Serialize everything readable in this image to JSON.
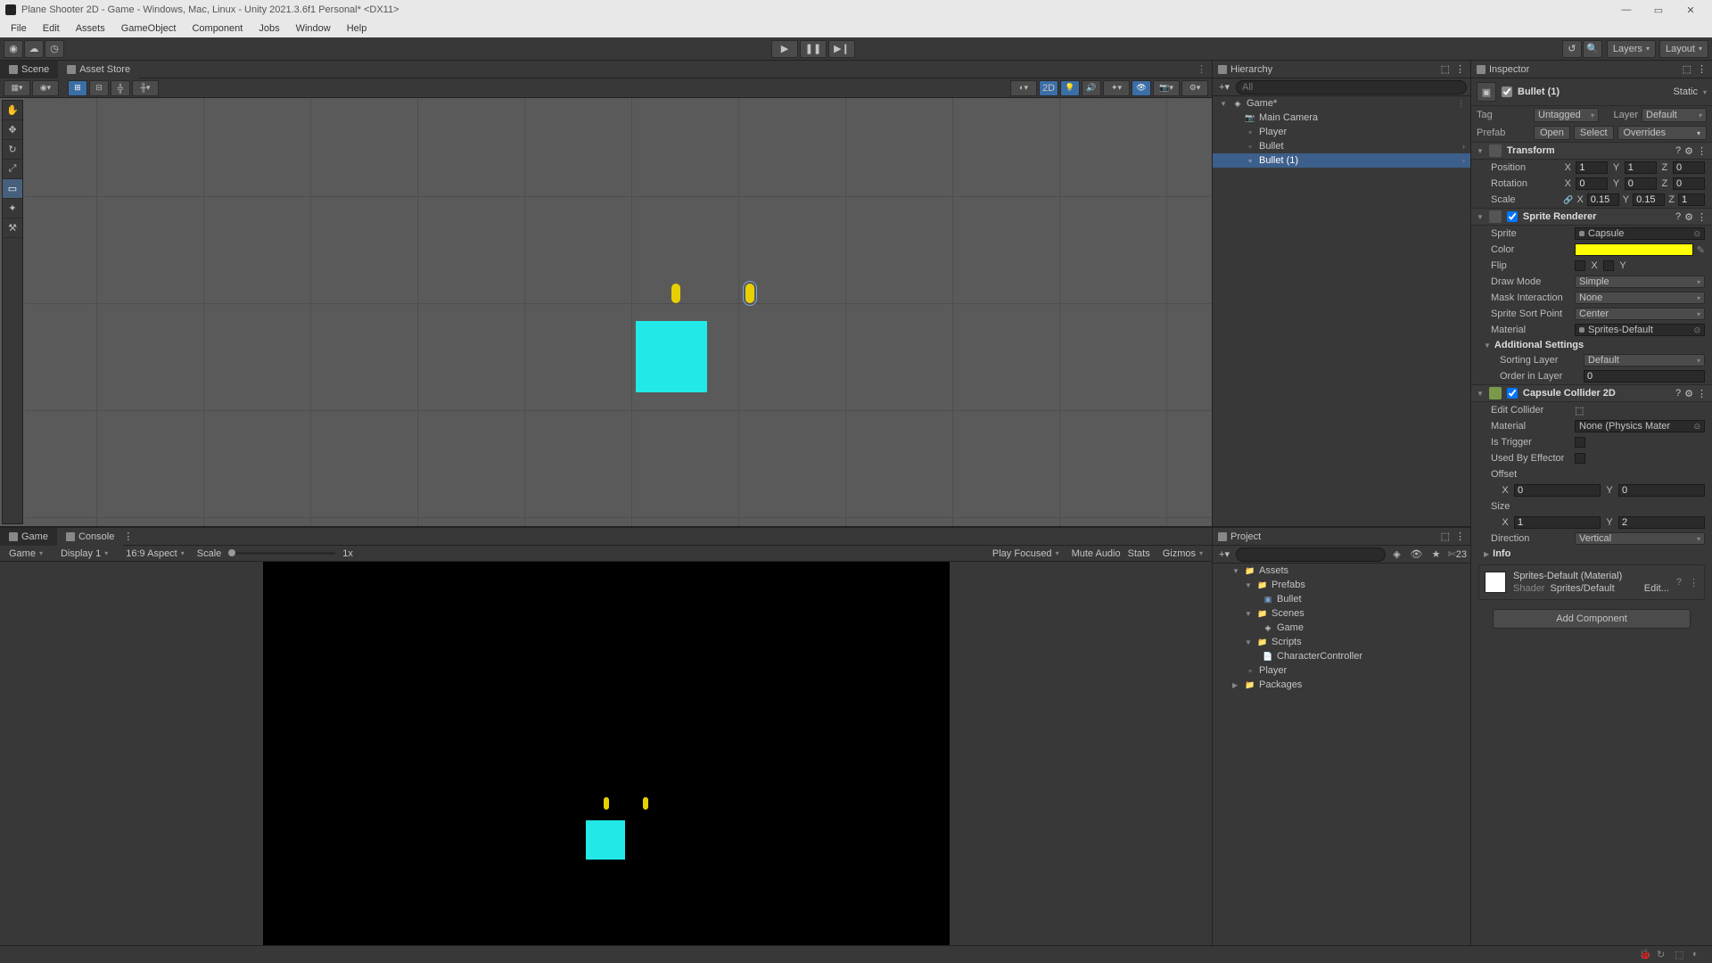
{
  "window": {
    "title": "Plane Shooter 2D - Game - Windows, Mac, Linux - Unity 2021.3.6f1 Personal* <DX11>"
  },
  "menu": [
    "File",
    "Edit",
    "Assets",
    "GameObject",
    "Component",
    "Jobs",
    "Window",
    "Help"
  ],
  "toolbar": {
    "layers": "Layers",
    "layout": "Layout"
  },
  "scene": {
    "tab_scene": "Scene",
    "tab_asset": "Asset Store",
    "btn_2d": "2D"
  },
  "game": {
    "tab_game": "Game",
    "tab_console": "Console",
    "dd_game": "Game",
    "dd_display": "Display 1",
    "dd_aspect": "16:9 Aspect",
    "lbl_scale": "Scale",
    "lbl_1x": "1x",
    "dd_focus": "Play Focused",
    "lbl_mute": "Mute Audio",
    "lbl_stats": "Stats",
    "lbl_gizmos": "Gizmos"
  },
  "hierarchy": {
    "title": "Hierarchy",
    "search_ph": "All",
    "root": "Game*",
    "items": [
      "Main Camera",
      "Player",
      "Bullet",
      "Bullet (1)"
    ]
  },
  "project": {
    "title": "Project",
    "favorites_hidden": "",
    "assets": "Assets",
    "prefabs": "Prefabs",
    "bullet": "Bullet",
    "scenes": "Scenes",
    "game": "Game",
    "scripts": "Scripts",
    "charctrl": "CharacterController",
    "player": "Player",
    "packages": "Packages",
    "slider_val": "23"
  },
  "inspector": {
    "title": "Inspector",
    "obj_name": "Bullet (1)",
    "static": "Static",
    "tag_lbl": "Tag",
    "tag_val": "Untagged",
    "layer_lbl": "Layer",
    "layer_val": "Default",
    "prefab_lbl": "Prefab",
    "btn_open": "Open",
    "btn_select": "Select",
    "btn_overrides": "Overrides",
    "transform": {
      "title": "Transform",
      "pos": "Position",
      "px": "1",
      "py": "1",
      "pz": "0",
      "rot": "Rotation",
      "rx": "0",
      "ry": "0",
      "rz": "0",
      "scl": "Scale",
      "sx": "0.15",
      "sy": "0.15",
      "sz": "1"
    },
    "sprite": {
      "title": "Sprite Renderer",
      "sprite_lbl": "Sprite",
      "sprite_val": "Capsule",
      "color_lbl": "Color",
      "flip_lbl": "Flip",
      "flip_x": "X",
      "flip_y": "Y",
      "draw_lbl": "Draw Mode",
      "draw_val": "Simple",
      "mask_lbl": "Mask Interaction",
      "mask_val": "None",
      "sort_lbl": "Sprite Sort Point",
      "sort_val": "Center",
      "mat_lbl": "Material",
      "mat_val": "Sprites-Default",
      "addl": "Additional Settings",
      "sortlayer_lbl": "Sorting Layer",
      "sortlayer_val": "Default",
      "order_lbl": "Order in Layer",
      "order_val": "0"
    },
    "collider": {
      "title": "Capsule Collider 2D",
      "edit_lbl": "Edit Collider",
      "mat_lbl": "Material",
      "mat_val": "None (Physics Mater",
      "trig_lbl": "Is Trigger",
      "eff_lbl": "Used By Effector",
      "off_lbl": "Offset",
      "ox": "0",
      "oy": "0",
      "size_lbl": "Size",
      "sx": "1",
      "sy": "2",
      "dir_lbl": "Direction",
      "dir_val": "Vertical",
      "info_lbl": "Info"
    },
    "material": {
      "name": "Sprites-Default (Material)",
      "shader_lbl": "Shader",
      "shader_val": "Sprites/Default",
      "edit": "Edit..."
    },
    "add_comp": "Add Component"
  }
}
